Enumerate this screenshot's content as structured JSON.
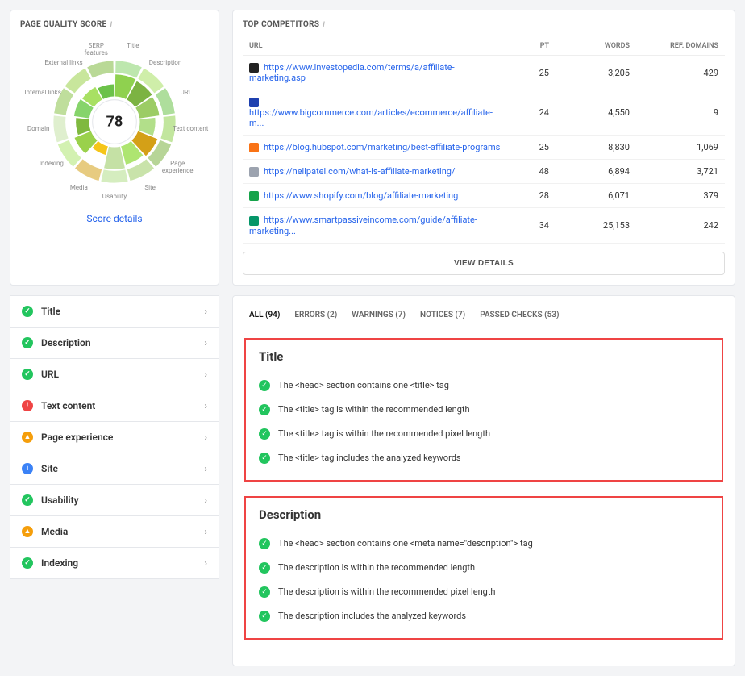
{
  "quality_panel": {
    "title": "PAGE QUALITY SCORE",
    "score": "78",
    "details_link": "Score details",
    "labels": [
      "Title",
      "Description",
      "URL",
      "Text content",
      "Page experience",
      "Site",
      "Usability",
      "Media",
      "Indexing",
      "Domain",
      "Internal links",
      "External links",
      "SERP features"
    ]
  },
  "competitors_panel": {
    "title": "TOP COMPETITORS",
    "headers": {
      "url": "URL",
      "pt": "PT",
      "words": "WORDS",
      "ref": "REF. DOMAINS"
    },
    "rows": [
      {
        "color": "#222",
        "url": "https://www.investopedia.com/terms/a/affiliate-marketing.asp",
        "pt": "25",
        "words": "3,205",
        "ref": "429"
      },
      {
        "color": "#1e40af",
        "url": "https://www.bigcommerce.com/articles/ecommerce/affiliate-m...",
        "pt": "24",
        "words": "4,550",
        "ref": "9"
      },
      {
        "color": "#f97316",
        "url": "https://blog.hubspot.com/marketing/best-affiliate-programs",
        "pt": "25",
        "words": "8,830",
        "ref": "1,069"
      },
      {
        "color": "#9ca3af",
        "url": "https://neilpatel.com/what-is-affiliate-marketing/",
        "pt": "48",
        "words": "6,894",
        "ref": "3,721"
      },
      {
        "color": "#16a34a",
        "url": "https://www.shopify.com/blog/affiliate-marketing",
        "pt": "28",
        "words": "6,071",
        "ref": "379"
      },
      {
        "color": "#059669",
        "url": "https://www.smartpassiveincome.com/guide/affiliate-marketing...",
        "pt": "34",
        "words": "25,153",
        "ref": "242"
      }
    ],
    "view_details": "VIEW DETAILS"
  },
  "sidebar": {
    "items": [
      {
        "status": "ok",
        "label": "Title"
      },
      {
        "status": "ok",
        "label": "Description"
      },
      {
        "status": "ok",
        "label": "URL"
      },
      {
        "status": "error",
        "label": "Text content"
      },
      {
        "status": "warn",
        "label": "Page experience"
      },
      {
        "status": "info",
        "label": "Site"
      },
      {
        "status": "ok",
        "label": "Usability"
      },
      {
        "status": "warn",
        "label": "Media"
      },
      {
        "status": "ok",
        "label": "Indexing"
      }
    ]
  },
  "tabs": [
    {
      "label": "ALL (94)",
      "active": true
    },
    {
      "label": "ERRORS (2)"
    },
    {
      "label": "WARNINGS (7)"
    },
    {
      "label": "NOTICES (7)"
    },
    {
      "label": "PASSED CHECKS (53)"
    }
  ],
  "sections": [
    {
      "title": "Title",
      "checks": [
        "The <head> section contains one <title> tag",
        "The <title> tag is within the recommended length",
        "The <title> tag is within the recommended pixel length",
        "The <title> tag includes the analyzed keywords"
      ]
    },
    {
      "title": "Description",
      "checks": [
        "The <head> section contains one <meta name=\"description\"> tag",
        "The description is within the recommended length",
        "The description is within the recommended pixel length",
        "The description includes the analyzed keywords"
      ]
    }
  ],
  "chart_data": {
    "type": "pie",
    "title": "Page Quality Score",
    "center_value": 78,
    "categories": [
      "Title",
      "Description",
      "URL",
      "Text content",
      "Page experience",
      "Site",
      "Usability",
      "Media",
      "Indexing",
      "Domain",
      "Internal links",
      "External links",
      "SERP features"
    ],
    "series": [
      {
        "name": "inner_ring_score_pct",
        "values": [
          100,
          95,
          90,
          70,
          95,
          85,
          100,
          40,
          80,
          60,
          70,
          65,
          55
        ]
      }
    ],
    "note": "radial segments; outer ring approximately uniform, inner ring length encodes category score"
  }
}
